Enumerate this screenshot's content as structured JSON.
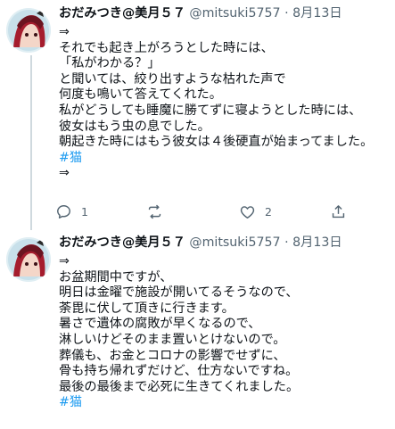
{
  "tweets": [
    {
      "name": "おだみつき@美月５７",
      "handle": "@mitsuki5757",
      "separator": "·",
      "date": "8月13日",
      "lines": [
        "⇒",
        "それでも起き上がろうとした時には、",
        "「私がわかる？」",
        "と聞いては、絞り出すような枯れた声で",
        "何度も鳴いて答えてくれた。",
        "私がどうしても睡魔に勝てずに寝ようとした時には、",
        "彼女はもう虫の息でした。",
        "朝起きた時にはもう彼女は４後硬直が始まってました。"
      ],
      "hashtag": "#猫",
      "tail": "⇒",
      "reply_count": "1",
      "retweet_count": "",
      "like_count": "2",
      "icons": [
        "reply-icon",
        "retweet-icon",
        "like-icon",
        "share-icon"
      ]
    },
    {
      "name": "おだみつき@美月５７",
      "handle": "@mitsuki5757",
      "separator": "·",
      "date": "8月13日",
      "lines": [
        "⇒",
        "お盆期間中ですが、",
        "明日は金曜で施設が開いてるそうなので、",
        "荼毘に伏して頂きに行きます。",
        "暑さで遺体の腐敗が早くなるので、",
        "淋しいけどそのまま置いとけないので。",
        "葬儀も、お金とコロナの影響でせずに、",
        "骨も持ち帰れずだけど、仕方ないですね。",
        "最後の最後まで必死に生きてくれました。"
      ],
      "hashtag": "#猫"
    }
  ],
  "colors": {
    "text": "#0f1419",
    "secondary": "#536471",
    "link": "#1d9bf0",
    "thread_line": "#cfd9de",
    "divider": "#eff3f4"
  }
}
